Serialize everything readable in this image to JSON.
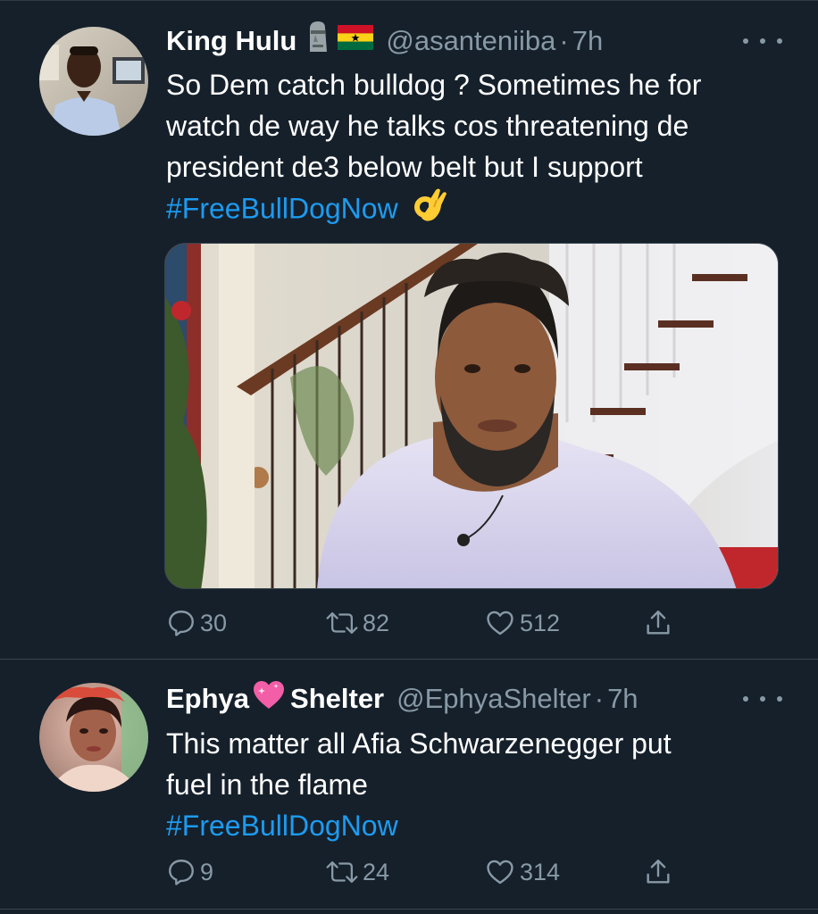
{
  "tweets": [
    {
      "author": {
        "name": "King Hulu",
        "emojis": [
          "moai",
          "ghana-flag"
        ],
        "handle": "@asanteniiba",
        "time": "7h"
      },
      "text_lines": [
        "So Dem catch bulldog ? Sometimes he for",
        "watch de way he talks cos threatening de",
        "president de3 below belt but I support"
      ],
      "hashtag": "#FreeBullDogNow",
      "trailing_emoji": "ok-hand",
      "has_media": true,
      "stats": {
        "replies": "30",
        "retweets": "82",
        "likes": "512"
      }
    },
    {
      "author": {
        "name_part1": "Ephya",
        "name_emoji": "sparkling-heart",
        "name_part2": "Shelter",
        "handle": "@EphyaShelter",
        "time": "7h"
      },
      "text_lines": [
        "This matter all Afia Schwarzenegger put",
        "fuel in the flame"
      ],
      "hashtag": "#FreeBullDogNow",
      "has_media": false,
      "stats": {
        "replies": "9",
        "retweets": "24",
        "likes": "314"
      }
    }
  ],
  "colors": {
    "background": "#15202b",
    "text": "#ffffff",
    "secondary": "#8899a6",
    "link": "#1d9bf0",
    "divider": "#38444d"
  },
  "separator": "·"
}
